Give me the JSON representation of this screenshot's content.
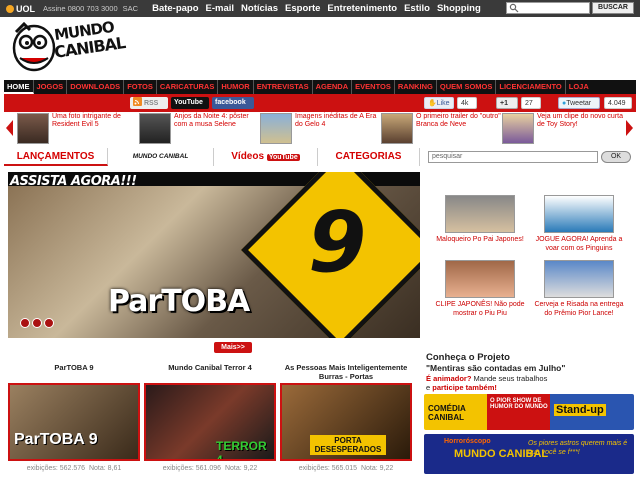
{
  "uolbar": {
    "logo": "UOL",
    "assine": "Assine 0800 703 3000",
    "sac": "SAC",
    "links": [
      "Bate-papo",
      "E-mail",
      "Notícias",
      "Esporte",
      "Entretenimento",
      "Estilo",
      "Shopping"
    ],
    "search_button": "BUSCAR"
  },
  "logo": {
    "line1": "MUNDO",
    "line2": "CANIBAL"
  },
  "nav": [
    "HOME",
    "JOGOS",
    "DOWNLOADS",
    "FOTOS",
    "CARICATURAS",
    "HUMOR",
    "ENTREVISTAS",
    "AGENDA",
    "EVENTOS",
    "RANKING",
    "QUEM SOMOS",
    "LICENCIAMENTO",
    "LOJA"
  ],
  "social": {
    "rss": "RSS",
    "youtube": "YouTube",
    "facebook": "facebook",
    "like": "Like",
    "like_count": "4k",
    "plus": "+1",
    "plus_count": "27",
    "tweet": "Tweetar",
    "tweet_count": "4.049"
  },
  "carousel": [
    {
      "text": "Uma foto intrigante de Resident Evil 5"
    },
    {
      "text": "Anjos da Noite 4: pôster com a musa Selene"
    },
    {
      "text": "Imagens inéditas de A Era do Gelo 4"
    },
    {
      "text": "O primeiro trailer do \"outro\" Branca de Neve"
    },
    {
      "text": "Veja um clipe do novo curta de Toy Story!"
    }
  ],
  "tabs": {
    "lancamentos": "LANÇAMENTOS",
    "mundo": "MUNDO CANIBAL",
    "videos": "Vídeos",
    "videos_yt": "YouTube",
    "categorias": "CATEGORIAS",
    "search_placeholder": "pesquisar",
    "ok": "OK"
  },
  "hero": {
    "assista": "ASSISTA AGORA!!!",
    "nine": "9",
    "title": "ParTOBA"
  },
  "side_videos": [
    {
      "caption": "Maloqueiro Po Pai Japones!"
    },
    {
      "caption": "JOGUE AGORA! Aprenda a voar com os Pinguins"
    },
    {
      "caption": "CLIPE JAPONÊS! Não pode mostrar o Piu Piu"
    },
    {
      "caption": "Cerveja e Risada na entrega do Prêmio Pior Lance!"
    }
  ],
  "mais": "Mais>>",
  "cards": [
    {
      "title": "ParTOBA 9",
      "views": "exibições: 562.576",
      "nota": "Nota: 8,61",
      "art": "ParTOBA 9"
    },
    {
      "title": "Mundo Canibal Terror 4",
      "views": "exibições: 561.096",
      "nota": "Nota: 9,22",
      "art": "TERROR 4"
    },
    {
      "title": "As Pessoas Mais Inteligentemente Burras - Portas",
      "views": "exibições: 565.015",
      "nota": "Nota: 9,22",
      "art": "PORTA DESESPERADOS"
    }
  ],
  "sidebar": {
    "heading": "Conheça o Projeto",
    "quote": "\"Mentiras são contadas em Julho\"",
    "line1_pre": "É animador?",
    "line1_post": " Mande seus trabalhos",
    "line2_pre": "e ",
    "line2_link": "participe também!",
    "banner1": {
      "left": "COMÉDIA CANIBAL",
      "mid": "O PIOR SHOW DE HUMOR DO MUNDO",
      "right": "Stand-up"
    },
    "banner2": {
      "left": "Horroróscopo",
      "right": "MUNDO CANIBAL",
      "sub": "Os piores astros querem mais é que você se f***!"
    }
  },
  "colors": {
    "accent": "#cc1111",
    "nav_bg": "#111111",
    "uolbar_bg": "#3a3a3a"
  }
}
